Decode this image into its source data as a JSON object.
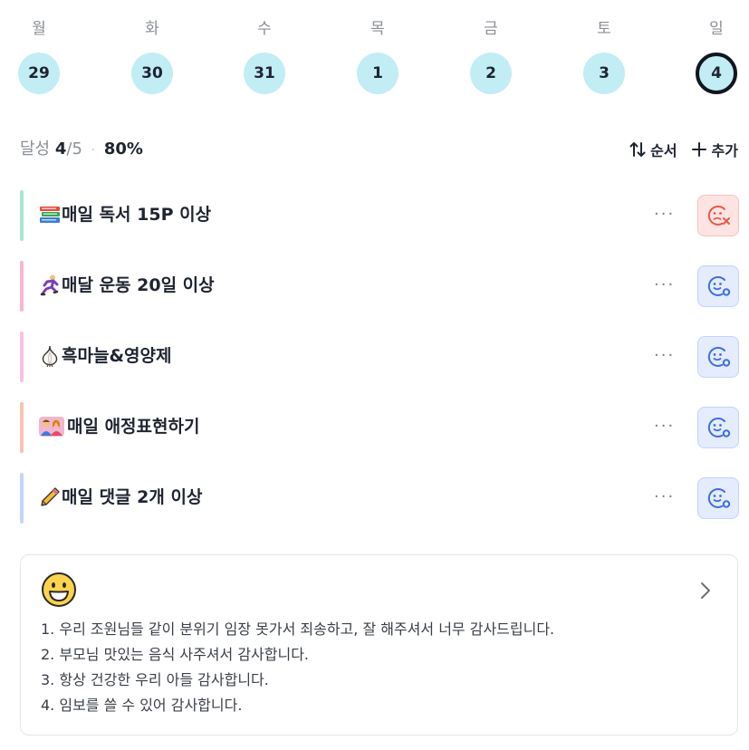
{
  "week": {
    "days": [
      {
        "name": "월",
        "date": "29"
      },
      {
        "name": "화",
        "date": "30"
      },
      {
        "name": "수",
        "date": "31"
      },
      {
        "name": "목",
        "date": "1"
      },
      {
        "name": "금",
        "date": "2"
      },
      {
        "name": "토",
        "date": "3"
      },
      {
        "name": "일",
        "date": "4"
      }
    ],
    "selected_date": "4"
  },
  "summary": {
    "label": "달성",
    "done": "4",
    "total": "/5",
    "separator": "·",
    "percent": "80%"
  },
  "toolbar": {
    "order_label": "순서",
    "add_label": "추가"
  },
  "habits": [
    {
      "title": "매일 독서 15P 이상",
      "emoji": "books-icon",
      "status": "fail",
      "color": "#a8e6cf"
    },
    {
      "title": "매달 운동 20일 이상",
      "emoji": "runner-icon",
      "status": "ok",
      "color": "#f7b6d2"
    },
    {
      "title": "흑마늘&영양제",
      "emoji": "garlic-icon",
      "status": "ok",
      "color": "#f7c2df"
    },
    {
      "title": "매일 애정표현하기",
      "emoji": "family-icon",
      "status": "ok",
      "color": "#f9c2b3"
    },
    {
      "title": "매일 댓글 2개 이상",
      "emoji": "pencil-icon",
      "status": "ok",
      "color": "#c6d4f7"
    }
  ],
  "habit_more_label": "···",
  "gratitude": {
    "icon": "grinning-face-icon",
    "lines": [
      "1. 우리 조원님들 같이 분위기 임장 못가서 죄송하고, 잘 해주셔서 너무 감사드립니다.",
      "2. 부모님 맛있는 음식 사주셔서 감사합니다.",
      "3. 항상 건강한 우리 아들 감사합니다.",
      "4. 임보를 쓸 수 있어 감사합니다."
    ]
  },
  "colors": {
    "day_circle": "#c2edf5",
    "fail_red": "#e8584a",
    "ok_blue": "#3f6fe0"
  }
}
